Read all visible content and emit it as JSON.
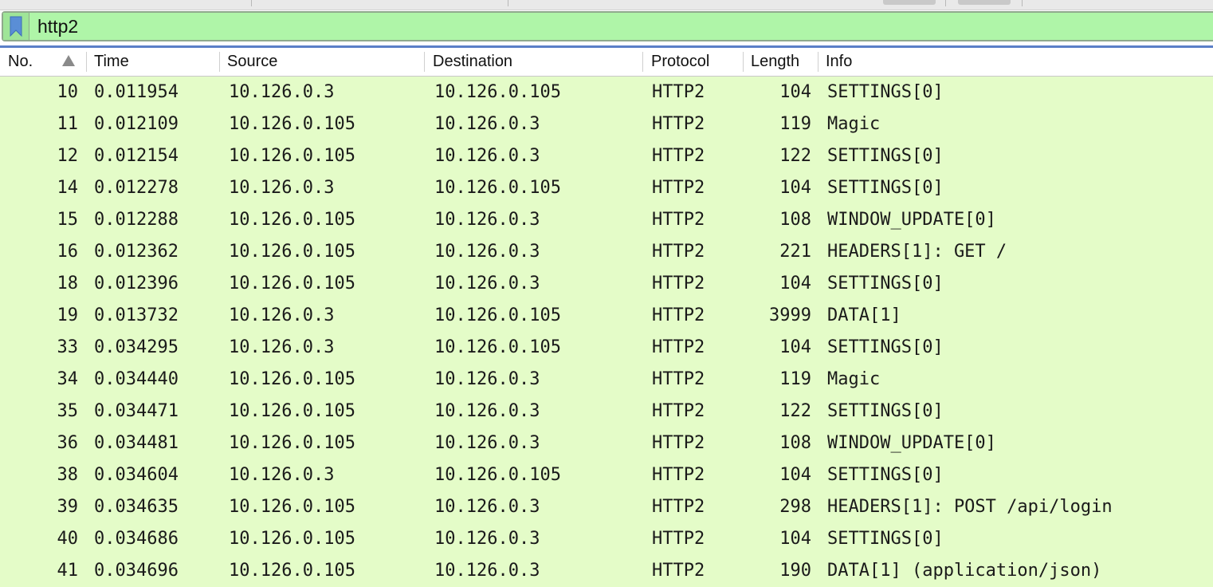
{
  "filter": {
    "value": "http2"
  },
  "columns": {
    "no": "No.",
    "time": "Time",
    "source": "Source",
    "destination": "Destination",
    "protocol": "Protocol",
    "length": "Length",
    "info": "Info"
  },
  "icons": {
    "bookmark": "bookmark-icon",
    "sort": "sort-ascending-icon"
  },
  "colors": {
    "filter_valid_bg": "#aff5a8",
    "row_bg": "#e4fcc8",
    "accent": "#5b7fc7"
  },
  "packets": [
    {
      "no": "10",
      "time": "0.011954",
      "source": "10.126.0.3",
      "destination": "10.126.0.105",
      "protocol": "HTTP2",
      "length": "104",
      "info": "SETTINGS[0]"
    },
    {
      "no": "11",
      "time": "0.012109",
      "source": "10.126.0.105",
      "destination": "10.126.0.3",
      "protocol": "HTTP2",
      "length": "119",
      "info": "Magic"
    },
    {
      "no": "12",
      "time": "0.012154",
      "source": "10.126.0.105",
      "destination": "10.126.0.3",
      "protocol": "HTTP2",
      "length": "122",
      "info": "SETTINGS[0]"
    },
    {
      "no": "14",
      "time": "0.012278",
      "source": "10.126.0.3",
      "destination": "10.126.0.105",
      "protocol": "HTTP2",
      "length": "104",
      "info": "SETTINGS[0]"
    },
    {
      "no": "15",
      "time": "0.012288",
      "source": "10.126.0.105",
      "destination": "10.126.0.3",
      "protocol": "HTTP2",
      "length": "108",
      "info": "WINDOW_UPDATE[0]"
    },
    {
      "no": "16",
      "time": "0.012362",
      "source": "10.126.0.105",
      "destination": "10.126.0.3",
      "protocol": "HTTP2",
      "length": "221",
      "info": "HEADERS[1]: GET /"
    },
    {
      "no": "18",
      "time": "0.012396",
      "source": "10.126.0.105",
      "destination": "10.126.0.3",
      "protocol": "HTTP2",
      "length": "104",
      "info": "SETTINGS[0]"
    },
    {
      "no": "19",
      "time": "0.013732",
      "source": "10.126.0.3",
      "destination": "10.126.0.105",
      "protocol": "HTTP2",
      "length": "3999",
      "info": "DATA[1]"
    },
    {
      "no": "33",
      "time": "0.034295",
      "source": "10.126.0.3",
      "destination": "10.126.0.105",
      "protocol": "HTTP2",
      "length": "104",
      "info": "SETTINGS[0]"
    },
    {
      "no": "34",
      "time": "0.034440",
      "source": "10.126.0.105",
      "destination": "10.126.0.3",
      "protocol": "HTTP2",
      "length": "119",
      "info": "Magic"
    },
    {
      "no": "35",
      "time": "0.034471",
      "source": "10.126.0.105",
      "destination": "10.126.0.3",
      "protocol": "HTTP2",
      "length": "122",
      "info": "SETTINGS[0]"
    },
    {
      "no": "36",
      "time": "0.034481",
      "source": "10.126.0.105",
      "destination": "10.126.0.3",
      "protocol": "HTTP2",
      "length": "108",
      "info": "WINDOW_UPDATE[0]"
    },
    {
      "no": "38",
      "time": "0.034604",
      "source": "10.126.0.3",
      "destination": "10.126.0.105",
      "protocol": "HTTP2",
      "length": "104",
      "info": "SETTINGS[0]"
    },
    {
      "no": "39",
      "time": "0.034635",
      "source": "10.126.0.105",
      "destination": "10.126.0.3",
      "protocol": "HTTP2",
      "length": "298",
      "info": "HEADERS[1]: POST /api/login"
    },
    {
      "no": "40",
      "time": "0.034686",
      "source": "10.126.0.105",
      "destination": "10.126.0.3",
      "protocol": "HTTP2",
      "length": "104",
      "info": "SETTINGS[0]"
    },
    {
      "no": "41",
      "time": "0.034696",
      "source": "10.126.0.105",
      "destination": "10.126.0.3",
      "protocol": "HTTP2",
      "length": "190",
      "info": "DATA[1] (application/json)"
    }
  ]
}
